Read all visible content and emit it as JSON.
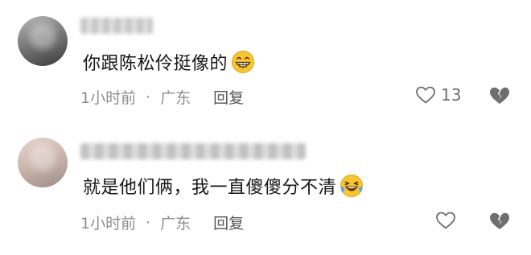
{
  "comments": [
    {
      "text": "你跟陈松伶挺像的",
      "emoji": "grinning-face",
      "time": "1小时前",
      "separator": "·",
      "location": "广东",
      "reply_label": "回复",
      "like_count": "13"
    },
    {
      "text": "就是他们俩，我一直傻傻分不清",
      "emoji": "laughing-tears-face",
      "time": "1小时前",
      "separator": "·",
      "location": "广东",
      "reply_label": "回复"
    }
  ],
  "colors": {
    "text": "#161616",
    "meta": "#8d8d8d",
    "icon": "#6e6e6e",
    "emoji_yellow": "#f7c531"
  }
}
